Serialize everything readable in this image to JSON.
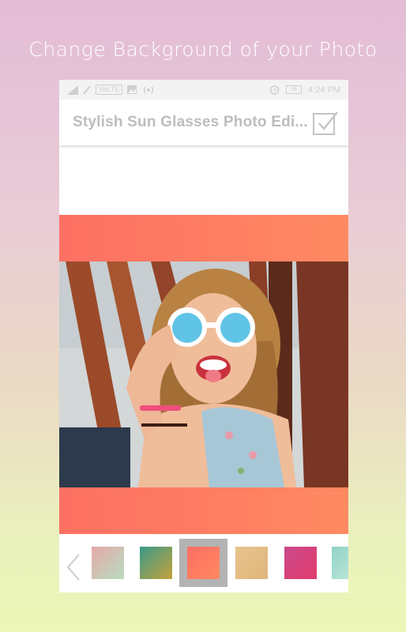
{
  "promo": {
    "title": "Change Background of your Photo"
  },
  "status_bar": {
    "volte": "VoLTE",
    "battery": "58",
    "time": "4:24 PM"
  },
  "toolbar": {
    "title": "Stylish Sun Glasses Photo Edi..."
  },
  "icons": {
    "confirm": "check-icon",
    "prev": "chevron-left-icon"
  },
  "swatches": [
    {
      "name": "gradient-rose-sage",
      "colors": [
        "#e4a9a8",
        "#b9dcc1"
      ]
    },
    {
      "name": "gradient-teal-gold",
      "colors": [
        "#3a9a88",
        "#c6a23c"
      ]
    },
    {
      "name": "gradient-coral",
      "colors": [
        "#fe6d63",
        "#fe8a62"
      ],
      "selected": true
    },
    {
      "name": "gradient-tan",
      "colors": [
        "#e7c48c",
        "#dfb47c"
      ]
    },
    {
      "name": "gradient-magenta",
      "colors": [
        "#c94a8c",
        "#e33b6a"
      ]
    },
    {
      "name": "gradient-aqua",
      "colors": [
        "#8fd3c5",
        "#b8e4d8"
      ]
    }
  ]
}
